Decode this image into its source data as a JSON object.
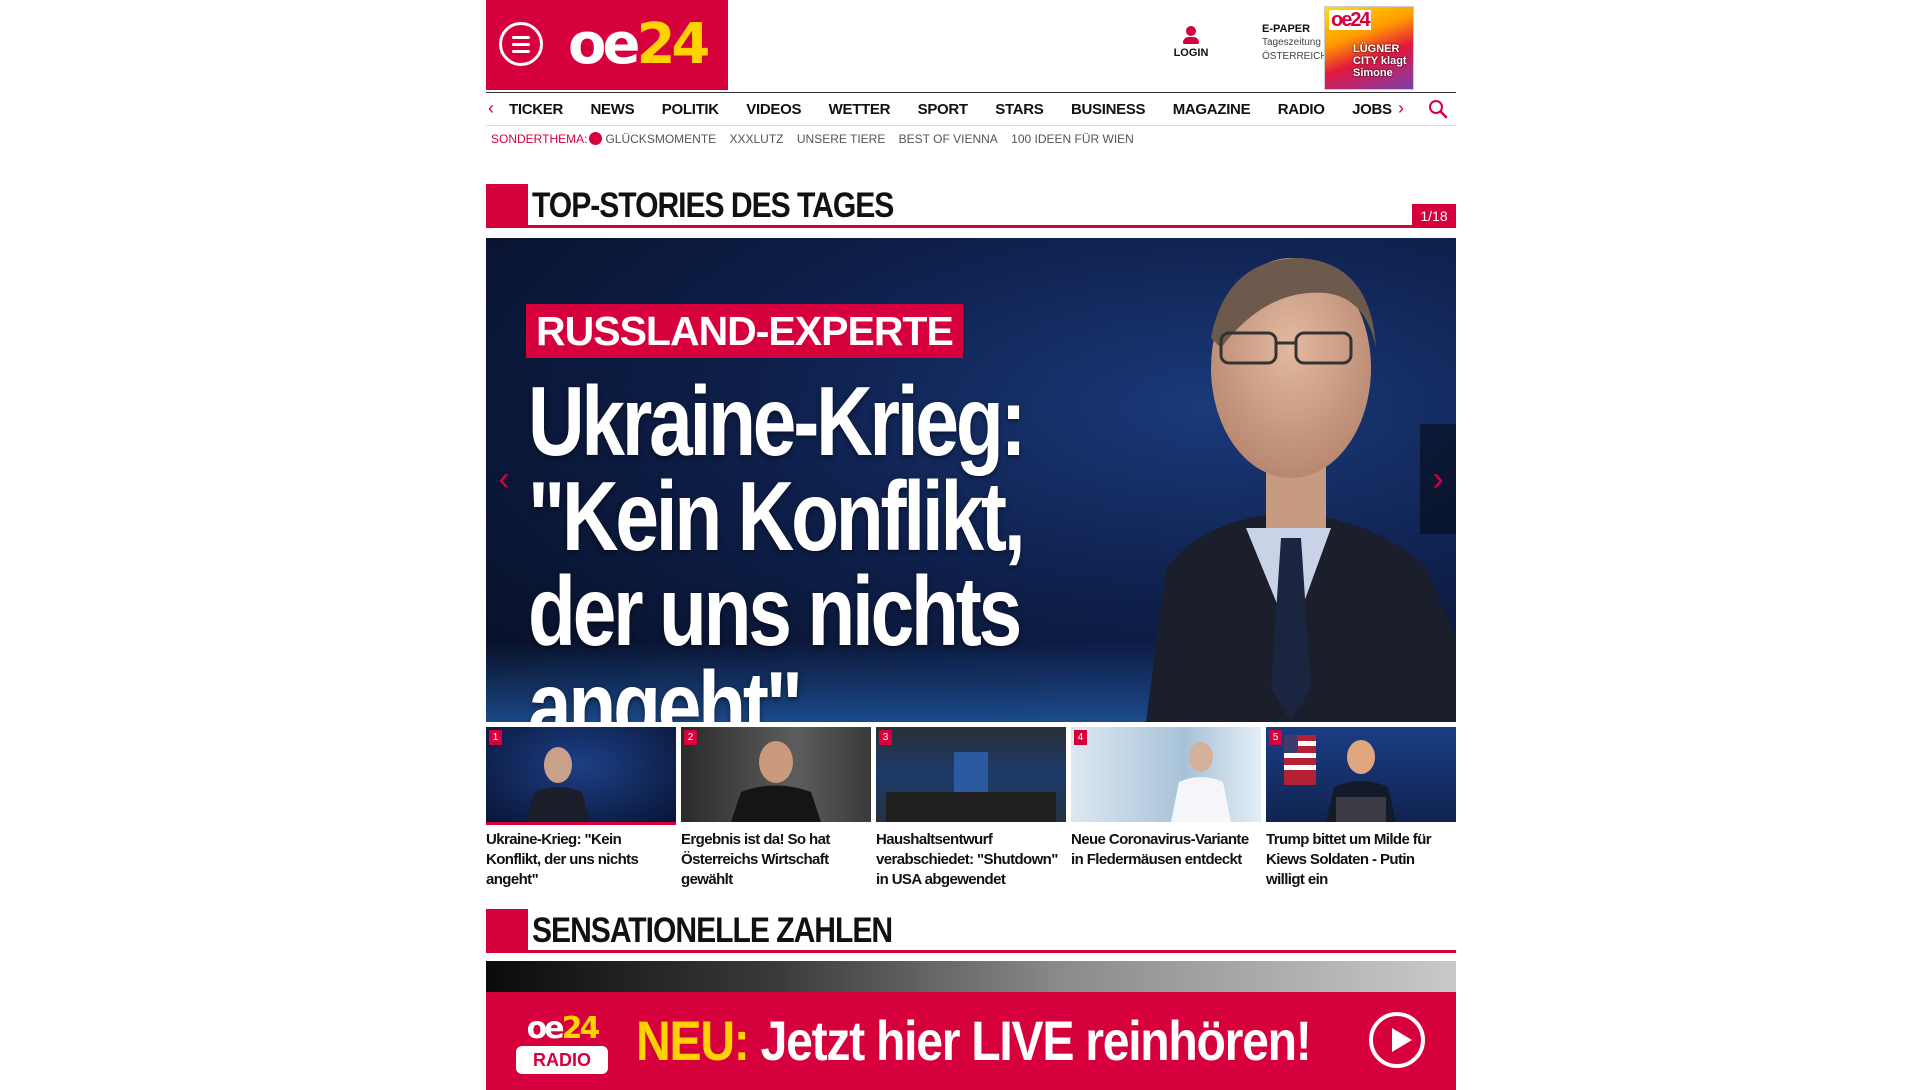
{
  "header": {
    "logo_main": "oe",
    "logo_num": "24",
    "login_label": "LOGIN",
    "epaper": {
      "title": "E-PAPER",
      "line1": "Tageszeitung",
      "line2": "ÖSTERREICH",
      "cover_logo": "oe24",
      "cover_headline": "LÜGNER CITY klagt Simone"
    }
  },
  "nav": {
    "items": [
      "TICKER",
      "NEWS",
      "POLITIK",
      "VIDEOS",
      "WETTER",
      "SPORT",
      "STARS",
      "BUSINESS",
      "MAGAZINE",
      "RADIO",
      "JOBS"
    ],
    "prev_icon": "chevron-left-icon",
    "next_icon": "chevron-right-icon",
    "search_icon": "search-icon"
  },
  "subnav": {
    "label": "SONDERTHEMA:",
    "items": [
      "GLÜCKSMOMENTE",
      "XXXLUTZ",
      "UNSERE TIERE",
      "BEST OF VIENNA",
      "100 IDEEN FÜR WIEN"
    ]
  },
  "top_stories": {
    "title": "TOP-STORIES DES TAGES",
    "pager": "1/18",
    "hero": {
      "kicker": "RUSSLAND-EXPERTE",
      "headline": "Ukraine-Krieg: \"Kein Konflikt, der uns nichts angeht\""
    },
    "thumbs": [
      {
        "num": "1",
        "caption": "Ukraine-Krieg: \"Kein Konflikt, der uns nichts angeht\""
      },
      {
        "num": "2",
        "caption": "Ergebnis ist da! So hat Österreichs Wirtschaft gewählt"
      },
      {
        "num": "3",
        "caption": "Haushaltsentwurf verabschiedet: \"Shutdown\" in USA abgewendet"
      },
      {
        "num": "4",
        "caption": "Neue Coronavirus-Variante in Fledermäusen entdeckt"
      },
      {
        "num": "5",
        "caption": "Trump bittet um Milde für Kiews Soldaten - Putin willigt ein"
      }
    ]
  },
  "second_section": {
    "title": "SENSATIONELLE ZAHLEN"
  },
  "radio_banner": {
    "logo_main": "oe",
    "logo_num": "24",
    "logo_sub": "RADIO",
    "neu": "NEU:",
    "text": "Jetzt hier LIVE reinhören!"
  },
  "colors": {
    "brand_red": "#d6003d",
    "brand_yellow": "#ffd200"
  }
}
